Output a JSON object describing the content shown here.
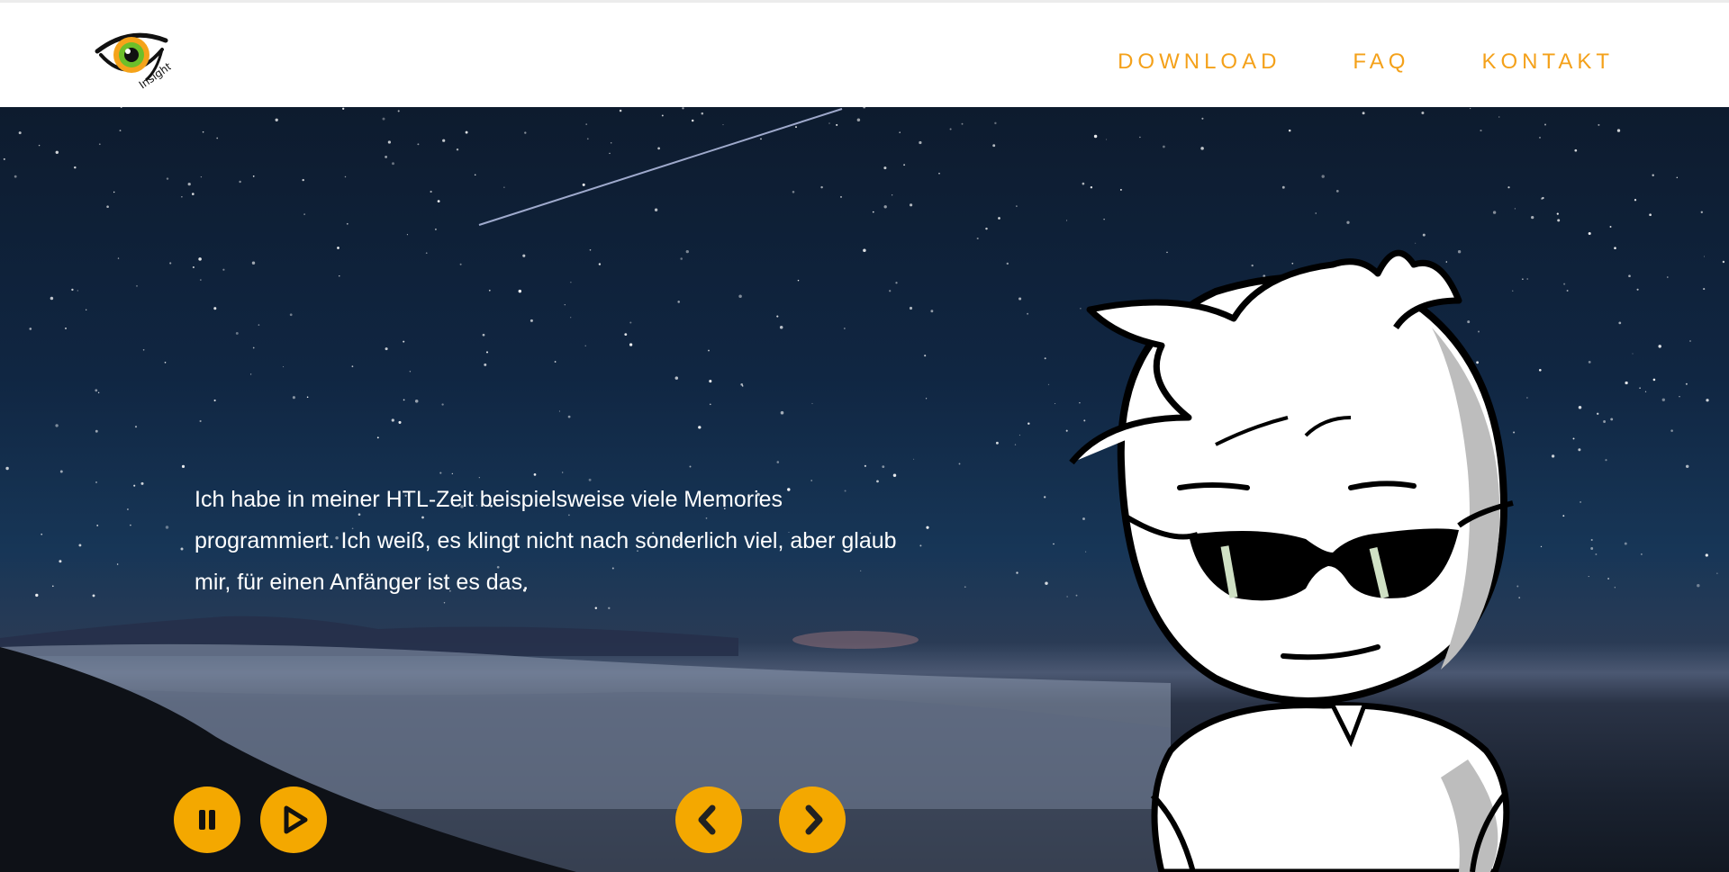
{
  "header": {
    "logo": {
      "icon": "insight-eye-logo-icon",
      "text": "Insight"
    },
    "nav": [
      {
        "label": "DOWNLOAD"
      },
      {
        "label": "FAQ"
      },
      {
        "label": "KONTAKT"
      }
    ]
  },
  "hero": {
    "text": "Ich habe in meiner HTL-Zeit beispielsweise viele Memories programmiert. Ich weiß, es klingt nicht nach sonderlich viel, aber glaub mir, für einen Anfänger ist es das.",
    "controls": {
      "pause_icon": "pause-icon",
      "play_icon": "play-icon",
      "prev_icon": "chevron-left-icon",
      "next_icon": "chevron-right-icon"
    }
  },
  "colors": {
    "accent": "#f4a11a",
    "button": "#f4a800"
  }
}
